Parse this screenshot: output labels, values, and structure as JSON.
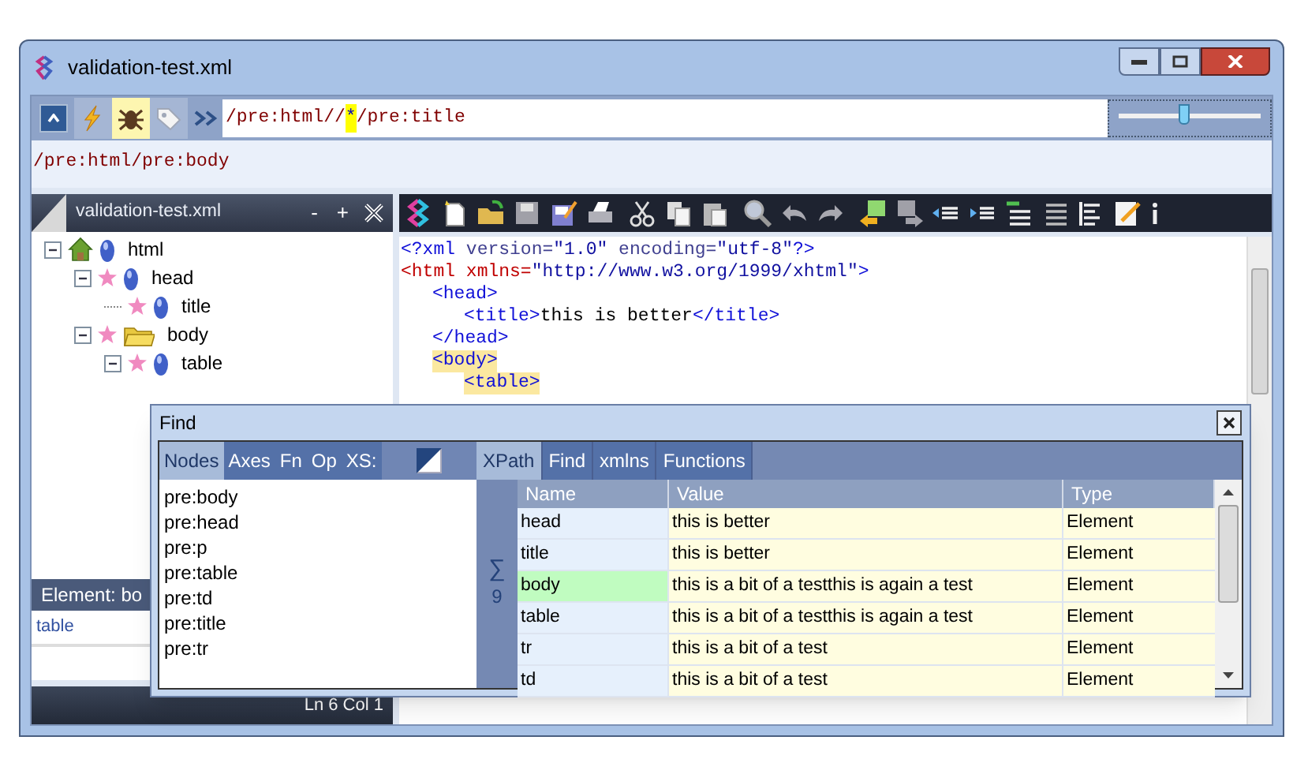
{
  "window": {
    "title": "validation-test.xml"
  },
  "toolbar": {
    "toggles": [
      {
        "kind": "lightning",
        "on": false
      },
      {
        "kind": "bug",
        "on": true
      },
      {
        "kind": "tag",
        "on": false
      }
    ],
    "xpath": [
      {
        "text": "/pre:html//",
        "highlighted": false
      },
      {
        "text": "*",
        "highlighted": true
      },
      {
        "text": "/pre:title",
        "highlighted": false
      }
    ],
    "zoom_slider": {
      "level": 0.48
    }
  },
  "current_path": "/pre:html/pre:body",
  "tree_panel": {
    "title": "validation-test.xml",
    "buttons": [
      "-",
      "+"
    ],
    "items": [
      {
        "label": "html",
        "kind": "root",
        "expanded": true,
        "children": [
          {
            "label": "head",
            "kind": "element",
            "expanded": true,
            "children": [
              {
                "label": "title",
                "kind": "element"
              }
            ]
          },
          {
            "label": "body",
            "kind": "folder",
            "expanded": true,
            "children": [
              {
                "label": "table",
                "kind": "element",
                "expanded": true
              }
            ]
          }
        ]
      }
    ]
  },
  "editor": {
    "lines": [
      {
        "tokens": [
          {
            "text": "<?xml",
            "kind": "markup"
          },
          {
            "text": " version=",
            "kind": "attr2"
          },
          {
            "text": "\"1.0\"",
            "kind": "value"
          },
          {
            "text": " encoding=",
            "kind": "attr2"
          },
          {
            "text": "\"utf-8\"",
            "kind": "value"
          },
          {
            "text": "?>",
            "kind": "markup"
          }
        ]
      },
      {
        "tokens": [
          {
            "text": "<html",
            "kind": "root"
          },
          {
            "text": " xmlns=",
            "kind": "attr"
          },
          {
            "text": "\"http://www.w3.org/1999/xhtml\"",
            "kind": "value"
          },
          {
            "text": ">",
            "kind": "markup"
          }
        ],
        "children": [
          {
            "tokens": [
              {
                "text": "<head>",
                "kind": "markup"
              }
            ],
            "children": [
              {
                "tokens": [
                  {
                    "text": "<title>",
                    "kind": "markup"
                  },
                  {
                    "text": "this is better",
                    "kind": "text"
                  },
                  {
                    "text": "</title>",
                    "kind": "markup"
                  }
                ]
              }
            ]
          },
          {
            "tokens": [
              {
                "text": "</head>",
                "kind": "markup"
              }
            ]
          },
          {
            "tokens": [
              {
                "text": "<body>",
                "kind": "markup"
              }
            ],
            "highlighted": true,
            "children": [
              {
                "tokens": [
                  {
                    "text": "<table>",
                    "kind": "markup"
                  }
                ],
                "highlighted": true
              }
            ]
          }
        ]
      }
    ]
  },
  "properties": {
    "header": "Element: bo",
    "rows": [
      "table"
    ]
  },
  "status_bar": {
    "position": "Ln 6 Col 1"
  },
  "find_dialog": {
    "title": "Find",
    "left_tabs": [
      {
        "label": "Nodes",
        "selected": true
      },
      {
        "label": "Axes",
        "selected": false
      },
      {
        "label": "Fn",
        "selected": false
      },
      {
        "label": "Op",
        "selected": false
      },
      {
        "label": "XS:",
        "selected": false
      }
    ],
    "node_list": [
      "pre:body",
      "pre:head",
      "pre:p",
      "pre:table",
      "pre:td",
      "pre:title",
      "pre:tr"
    ],
    "right_tabs": [
      {
        "label": "XPath",
        "selected": true
      },
      {
        "label": "Find",
        "selected": false
      },
      {
        "label": "xmlns",
        "selected": false
      },
      {
        "label": "Functions",
        "selected": false
      }
    ],
    "count_symbol": "∑",
    "count": "9",
    "columns": [
      "Name",
      "Value",
      "Type"
    ],
    "rows": [
      {
        "name": "head",
        "value": "this is better",
        "type": "Element",
        "selected": false
      },
      {
        "name": "title",
        "value": "this is better",
        "type": "Element",
        "selected": false
      },
      {
        "name": "body",
        "value": "this is a bit of a testthis is again a test",
        "type": "Element",
        "selected": true
      },
      {
        "name": "table",
        "value": "this is a bit of a testthis is again a test",
        "type": "Element",
        "selected": false
      },
      {
        "name": "tr",
        "value": "this is a bit of a test",
        "type": "Element",
        "selected": false
      },
      {
        "name": "td",
        "value": "this is a bit of a test",
        "type": "Element",
        "selected": false
      }
    ]
  }
}
